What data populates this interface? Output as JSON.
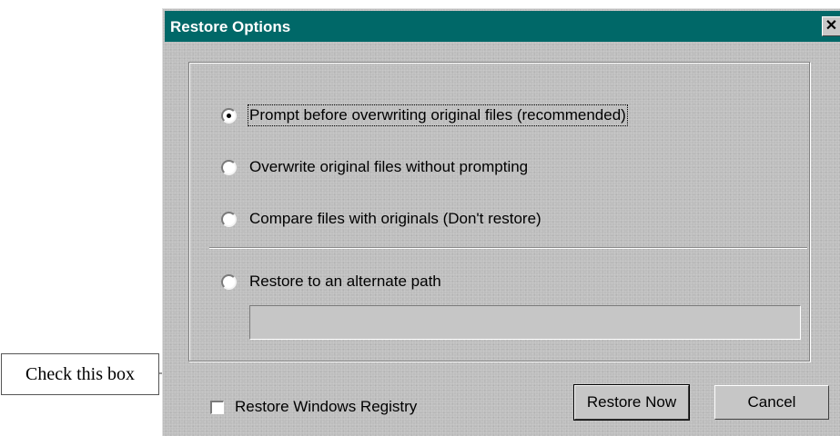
{
  "window": {
    "title": "Restore Options",
    "close_glyph": "✕"
  },
  "options": [
    {
      "label": "Prompt before overwriting original files (recommended)",
      "selected": true
    },
    {
      "label": "Overwrite original files without prompting",
      "selected": false
    },
    {
      "label": "Compare files with originals (Don't restore)",
      "selected": false
    },
    {
      "label": "Restore to an alternate path",
      "selected": false
    }
  ],
  "alternate_path": {
    "value": ""
  },
  "registry": {
    "label": "Restore Windows Registry",
    "checked": false
  },
  "buttons": {
    "restore_now": "Restore Now",
    "cancel": "Cancel"
  },
  "callout": {
    "text": "Check this box"
  },
  "colors": {
    "titlebar": "#006868",
    "dialog_bg": "#bdbdbd"
  }
}
